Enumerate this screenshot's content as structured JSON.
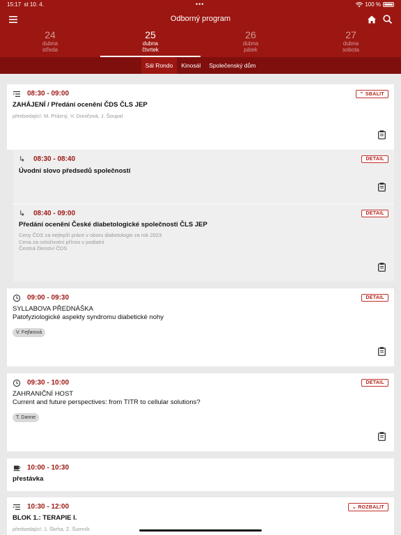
{
  "status": {
    "time": "15:17",
    "date": "st 10. 4.",
    "dots": "•••",
    "battery": "100 %"
  },
  "nav": {
    "title": "Odborný program",
    "menu_icon": "hamburger-menu-icon",
    "home_icon": "home-icon",
    "search_icon": "search-icon"
  },
  "days": [
    {
      "num": "24",
      "month": "dubna",
      "weekday": "středa"
    },
    {
      "num": "25",
      "month": "dubna",
      "weekday": "čtvrtek"
    },
    {
      "num": "26",
      "month": "dubna",
      "weekday": "pátek"
    },
    {
      "num": "27",
      "month": "dubna",
      "weekday": "sobota"
    }
  ],
  "halls": [
    "Sál Rondo",
    "Kinosál",
    "Společenský dům"
  ],
  "cards": {
    "c1": {
      "time": "08:30 - 09:00",
      "title": "ZAHÁJENÍ / Předání ocenění ČDS ČLS JEP",
      "chairs": "předsedající: M. Prázný, V. Doničová, J. Šoupal",
      "badge": "SBALIT"
    },
    "s1": {
      "time": "08:30 - 08:40",
      "title": "Úvodní slovo předsedů společností",
      "badge": "DETAIL"
    },
    "s2": {
      "time": "08:40 - 09:00",
      "title": "Předání ocenění České diabetologické společnosti ČLS JEP",
      "line1": "Ceny ČDS za nejlepší práce v oboru diabetologie za rok 2023",
      "line2": "Cena za celoživotní přínos v podiatrii",
      "line3": "Čestná členství ČDS",
      "badge": "DETAIL"
    },
    "c2": {
      "time": "09:00 - 09:30",
      "title": "SYLLABOVA PŘEDNÁŠKA",
      "subtitle": "Patofyziologické aspekty syndromu diabetické nohy",
      "speaker": "V. Fejfarová",
      "badge": "DETAIL"
    },
    "c3": {
      "time": "09:30 - 10:00",
      "title": "ZAHRANIČNÍ HOST",
      "subtitle": "Current and future perspectives: from TITR to cellular solutions?",
      "speaker": "T. Danne",
      "badge": "DETAIL"
    },
    "c4": {
      "time": "10:00 - 10:30",
      "title": "přestávka"
    },
    "c5": {
      "time": "10:30 - 12:00",
      "title": "BLOK 1.: TERAPIE I.",
      "chairs": "předsedající: J. Škrha, Z. Šumník",
      "badge": "ROZBALIT"
    }
  }
}
